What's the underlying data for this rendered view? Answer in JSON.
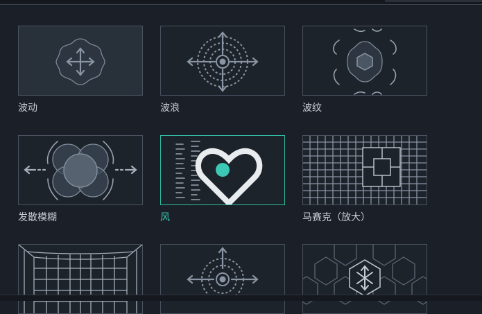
{
  "effects": [
    {
      "id": "wave",
      "label": "波动"
    },
    {
      "id": "ripple",
      "label": "波浪"
    },
    {
      "id": "ripple-pattern",
      "label": "波纹"
    },
    {
      "id": "radial-blur",
      "label": "发散模糊"
    },
    {
      "id": "wind",
      "label": "风"
    },
    {
      "id": "mosaic-zoom",
      "label": "马赛克（放大）"
    },
    {
      "id": "grid-warp",
      "label": ""
    },
    {
      "id": "radial-arrows",
      "label": ""
    },
    {
      "id": "hex-pattern",
      "label": ""
    }
  ],
  "colors": {
    "accent": "#2fbfa5",
    "icon": "#8a95a3",
    "text": "#c8cdd3"
  }
}
